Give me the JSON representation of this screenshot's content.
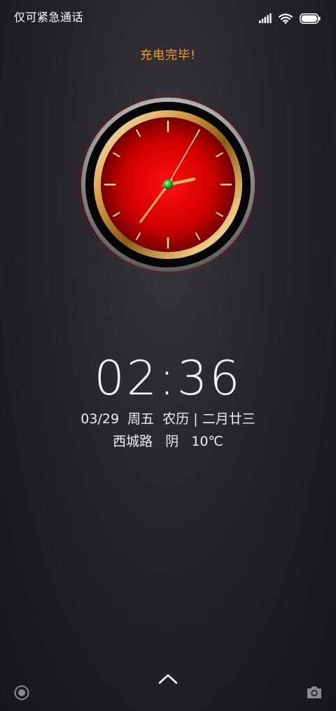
{
  "status_bar": {
    "carrier_text": "仅可紧急通话",
    "icons": [
      "signal-icon",
      "wifi-icon",
      "battery-icon"
    ]
  },
  "lock_screen": {
    "charge_message": "充电完毕!",
    "analog_clock": {
      "hour": 2,
      "minute": 36,
      "second": 5,
      "face_color": "#e00000",
      "rim_color": "#c89040",
      "hand_color": "#e0b060",
      "center_color": "#27c23a"
    },
    "time": "02:36",
    "date": "03/29",
    "weekday": "周五",
    "lunar_label": "农历",
    "lunar_separator": "|",
    "lunar_date": "二月廿三",
    "location": "西城路",
    "weather": "阴",
    "temperature": "10℃"
  },
  "bottom_bar": {
    "left_icon": "record-circle-icon",
    "center_icon": "chevron-up-icon",
    "right_icon": "camera-icon"
  },
  "colors": {
    "accent": "#e8a03a",
    "text": "#f0f0f0",
    "background": "#1e1d21"
  }
}
